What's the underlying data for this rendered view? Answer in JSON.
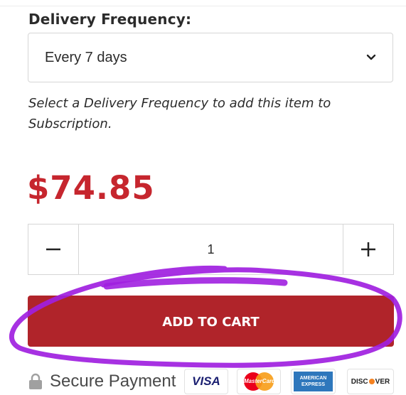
{
  "delivery": {
    "heading": "Delivery Frequency:",
    "selected": "Every 7 days",
    "helper": "Select a Delivery Frequency to add this item to Subscription."
  },
  "price": "$74.85",
  "quantity": {
    "value": "1"
  },
  "cart": {
    "label": "ADD TO CART"
  },
  "payment": {
    "secure_label": "Secure Payment",
    "cards": {
      "visa": "VISA",
      "mastercard": "MasterCard",
      "amex_line1": "AMERICAN",
      "amex_line2": "EXPRESS",
      "discover_pre": "DISC",
      "discover_post": "VER"
    }
  },
  "colors": {
    "price": "#c6262e",
    "cart_button": "#b0242a",
    "annotation": "#a020e0"
  }
}
